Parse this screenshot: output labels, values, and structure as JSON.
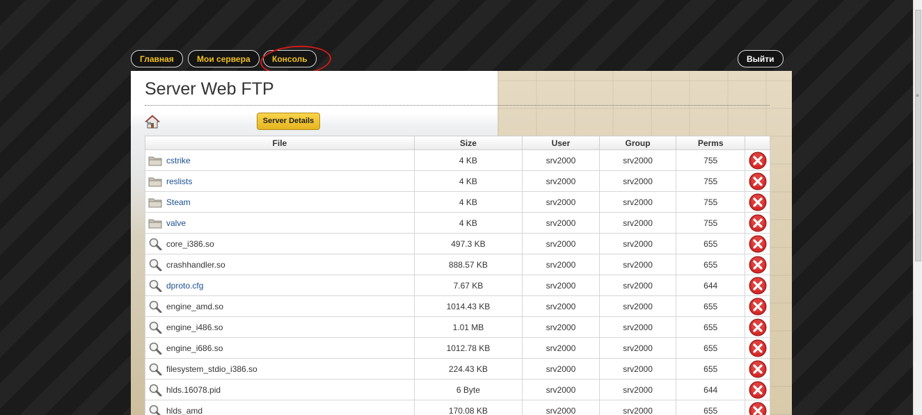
{
  "nav": {
    "home": "Главная",
    "servers": "Мои сервера",
    "console": "Консоль",
    "logout": "Выйти"
  },
  "page": {
    "title": "Server Web FTP",
    "server_details": "Server Details"
  },
  "table": {
    "headers": [
      "File",
      "Size",
      "User",
      "Group",
      "Perms"
    ],
    "rows": [
      {
        "name": "cstrike",
        "type": "folder",
        "size": "4 KB",
        "user": "srv2000",
        "group": "srv2000",
        "perms": "755"
      },
      {
        "name": "reslists",
        "type": "folder",
        "size": "4 KB",
        "user": "srv2000",
        "group": "srv2000",
        "perms": "755"
      },
      {
        "name": "Steam",
        "type": "folder",
        "size": "4 KB",
        "user": "srv2000",
        "group": "srv2000",
        "perms": "755"
      },
      {
        "name": "valve",
        "type": "folder",
        "size": "4 KB",
        "user": "srv2000",
        "group": "srv2000",
        "perms": "755"
      },
      {
        "name": "core_i386.so",
        "type": "file",
        "size": "497.3 KB",
        "user": "srv2000",
        "group": "srv2000",
        "perms": "655"
      },
      {
        "name": "crashhandler.so",
        "type": "file",
        "size": "888.57 KB",
        "user": "srv2000",
        "group": "srv2000",
        "perms": "655"
      },
      {
        "name": "dproto.cfg",
        "type": "file-link",
        "size": "7.67 KB",
        "user": "srv2000",
        "group": "srv2000",
        "perms": "644"
      },
      {
        "name": "engine_amd.so",
        "type": "file",
        "size": "1014.43 KB",
        "user": "srv2000",
        "group": "srv2000",
        "perms": "655"
      },
      {
        "name": "engine_i486.so",
        "type": "file",
        "size": "1.01 MB",
        "user": "srv2000",
        "group": "srv2000",
        "perms": "655"
      },
      {
        "name": "engine_i686.so",
        "type": "file",
        "size": "1012.78 KB",
        "user": "srv2000",
        "group": "srv2000",
        "perms": "655"
      },
      {
        "name": "filesystem_stdio_i386.so",
        "type": "file",
        "size": "224.43 KB",
        "user": "srv2000",
        "group": "srv2000",
        "perms": "655"
      },
      {
        "name": "hlds.16078.pid",
        "type": "file",
        "size": "6 Byte",
        "user": "srv2000",
        "group": "srv2000",
        "perms": "644"
      },
      {
        "name": "hlds_amd",
        "type": "file",
        "size": "170.08 KB",
        "user": "srv2000",
        "group": "srv2000",
        "perms": "655"
      }
    ]
  },
  "icons": {
    "home": "home-icon",
    "folder": "folder-icon",
    "file": "magnifier-icon",
    "delete": "delete-icon"
  },
  "colors": {
    "accent_gold": "#f0c020",
    "link": "#1a4f8f",
    "delete_red": "#d42a2a",
    "annotation_circle": "#d11a1a"
  }
}
